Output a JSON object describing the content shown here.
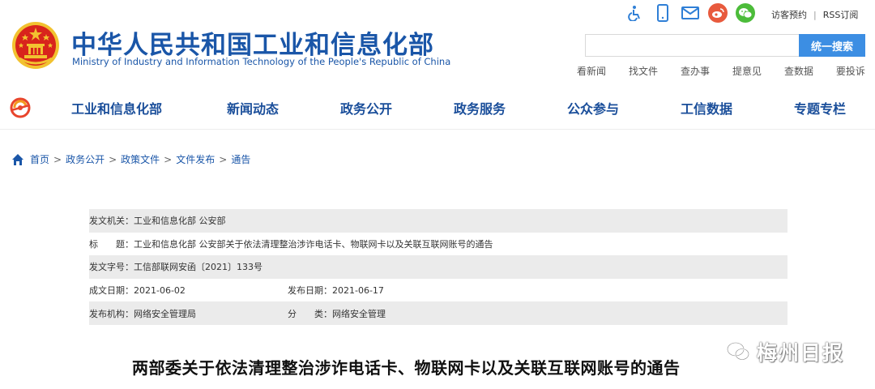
{
  "header": {
    "title": "中华人民共和国工业和信息化部",
    "subtitle": "Ministry of Industry and Information Technology of the People's Republic of China",
    "icons": [
      "accessibility-icon",
      "mobile-icon",
      "mail-icon",
      "weibo-icon",
      "wechat-icon"
    ],
    "visit_link": "访客预约",
    "link_separator": "|",
    "rss_link": "RSS订阅",
    "search_placeholder": "",
    "search_button": "统一搜索",
    "quick_links": [
      "看新闻",
      "找文件",
      "查办事",
      "提意见",
      "查数据",
      "要投诉"
    ]
  },
  "nav": {
    "items": [
      "工业和信息化部",
      "新闻动态",
      "政务公开",
      "政务服务",
      "公众参与",
      "工信数据",
      "专题专栏"
    ]
  },
  "breadcrumb": {
    "items": [
      "首页",
      "政务公开",
      "政策文件",
      "文件发布",
      "通告"
    ],
    "separator": ">"
  },
  "info": {
    "issuer_label": "发文机关：",
    "issuer": "工业和信息化部 公安部",
    "title_label": "标　　题：",
    "title": "工业和信息化部 公安部关于依法清理整治涉诈电话卡、物联网卡以及关联互联网账号的通告",
    "doc_no_label": "发文字号：",
    "doc_no": "工信部联网安函〔2021〕133号",
    "created_label": "成文日期：",
    "created": "2021-06-02",
    "published_label": "发布日期：",
    "published": "2021-06-17",
    "agency_label": "发布机构：",
    "agency": "网络安全管理局",
    "category_label": "分　　类：",
    "category": "网络安全管理"
  },
  "article": {
    "title": "两部委关于依法清理整治涉诈电话卡、物联网卡以及关联互联网账号的通告"
  },
  "watermark": {
    "text": "梅州日报"
  },
  "colors": {
    "brand_blue": "#1a56a8",
    "nav_blue": "#1a4e9a",
    "search_button": "#3c8ee3",
    "row_stripe": "#ebebeb",
    "emblem_red": "#d8241c",
    "emblem_gold": "#f2c230"
  }
}
